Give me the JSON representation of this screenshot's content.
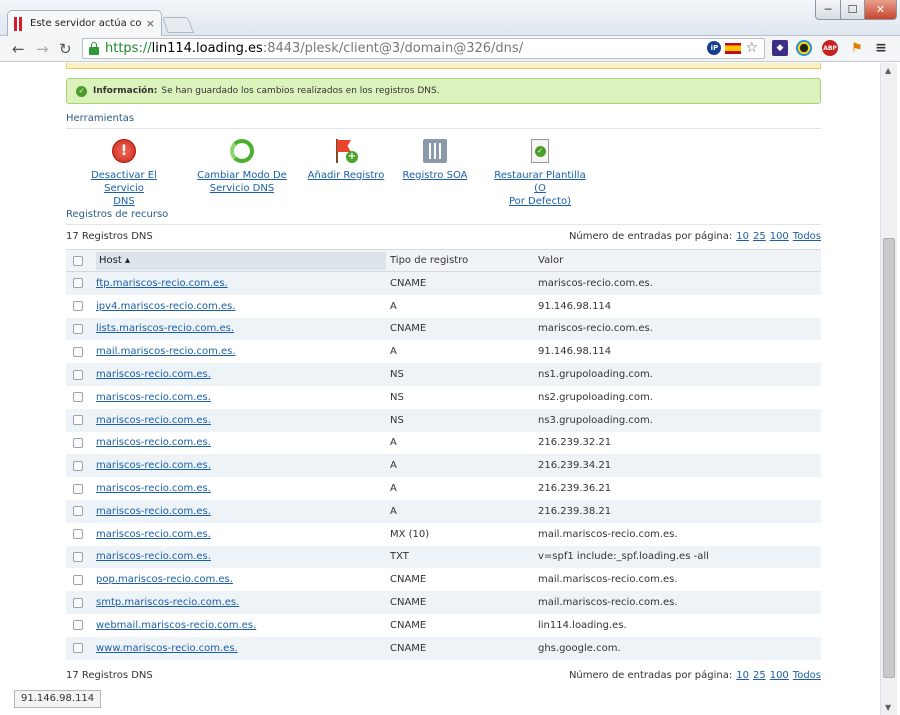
{
  "browser": {
    "tab_title": "Este servidor actúa como",
    "tab_close": "×",
    "url_scheme": "https://",
    "url_host": "lin114.loading.es",
    "url_path": ":8443/plesk/client@3/domain@326/dns/",
    "ext_ip": "iP",
    "ext_abp": "ABP",
    "star": "☆",
    "minimize": "─",
    "maximize": "☐",
    "close": "✕",
    "back": "←",
    "forward": "→",
    "reload": "↻",
    "menu": "≡"
  },
  "info": {
    "label": "Información:",
    "text": "Se han guardado los cambios realizados en los registros DNS."
  },
  "tools": {
    "title": "Herramientas",
    "items": [
      {
        "line1": "Desactivar El Servicio",
        "line2": "DNS",
        "icon": "disable-icon"
      },
      {
        "line1": "Cambiar Modo De",
        "line2": "Servicio DNS",
        "icon": "switch-icon"
      },
      {
        "line1": "Añadir Registro",
        "line2": "",
        "icon": "add-record-icon"
      },
      {
        "line1": "Registro SOA",
        "line2": "",
        "icon": "soa-icon"
      },
      {
        "line1": "Restaurar Plantilla (O",
        "line2": "Por Defecto)",
        "icon": "restore-icon"
      }
    ]
  },
  "records": {
    "title": "Registros de recurso",
    "count_label": "17 Registros DNS",
    "per_page_label": "Número de entradas por página:",
    "per_page_options": [
      "10",
      "25",
      "100",
      "Todos"
    ],
    "columns": {
      "host": "Host ▴",
      "type": "Tipo de registro",
      "value": "Valor"
    },
    "rows": [
      {
        "host": "ftp.mariscos-recio.com.es.",
        "type": "CNAME",
        "value": "mariscos-recio.com.es."
      },
      {
        "host": "ipv4.mariscos-recio.com.es.",
        "type": "A",
        "value": "91.146.98.114"
      },
      {
        "host": "lists.mariscos-recio.com.es.",
        "type": "CNAME",
        "value": "mariscos-recio.com.es."
      },
      {
        "host": "mail.mariscos-recio.com.es.",
        "type": "A",
        "value": "91.146.98.114"
      },
      {
        "host": "mariscos-recio.com.es.",
        "type": "NS",
        "value": "ns1.grupoloading.com."
      },
      {
        "host": "mariscos-recio.com.es.",
        "type": "NS",
        "value": "ns2.grupoloading.com."
      },
      {
        "host": "mariscos-recio.com.es.",
        "type": "NS",
        "value": "ns3.grupoloading.com."
      },
      {
        "host": "mariscos-recio.com.es.",
        "type": "A",
        "value": "216.239.32.21"
      },
      {
        "host": "mariscos-recio.com.es.",
        "type": "A",
        "value": "216.239.34.21"
      },
      {
        "host": "mariscos-recio.com.es.",
        "type": "A",
        "value": "216.239.36.21"
      },
      {
        "host": "mariscos-recio.com.es.",
        "type": "A",
        "value": "216.239.38.21"
      },
      {
        "host": "mariscos-recio.com.es.",
        "type": "MX (10)",
        "value": "mail.mariscos-recio.com.es."
      },
      {
        "host": "mariscos-recio.com.es.",
        "type": "TXT",
        "value": "v=spf1 include:_spf.loading.es -all"
      },
      {
        "host": "pop.mariscos-recio.com.es.",
        "type": "CNAME",
        "value": "mail.mariscos-recio.com.es."
      },
      {
        "host": "smtp.mariscos-recio.com.es.",
        "type": "CNAME",
        "value": "mail.mariscos-recio.com.es."
      },
      {
        "host": "webmail.mariscos-recio.com.es.",
        "type": "CNAME",
        "value": "lin114.loading.es."
      },
      {
        "host": "www.mariscos-recio.com.es.",
        "type": "CNAME",
        "value": "ghs.google.com."
      }
    ]
  },
  "statusbar": {
    "text": "91.146.98.114"
  }
}
